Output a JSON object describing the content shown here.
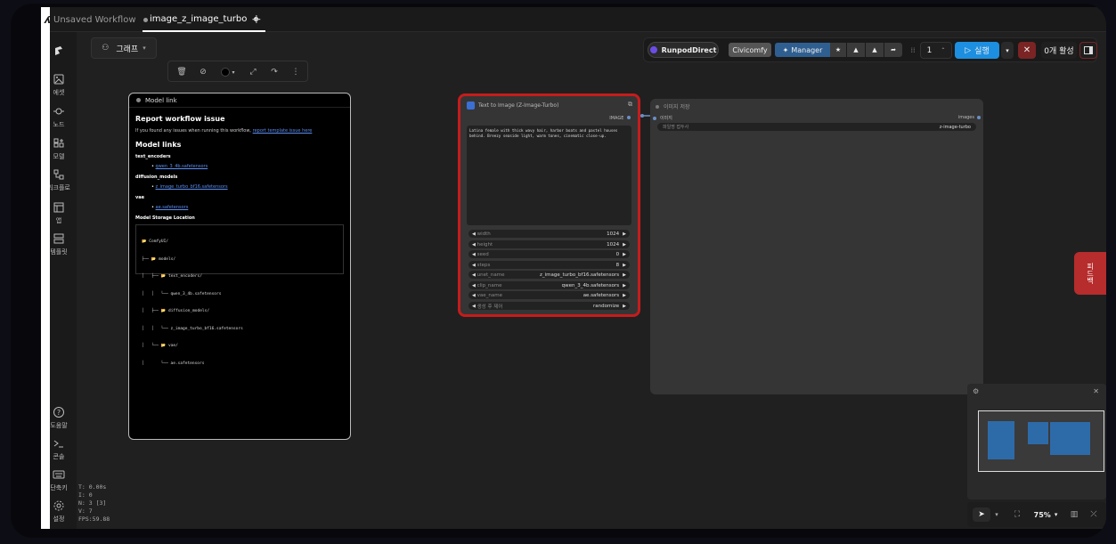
{
  "tabs": [
    {
      "label": "Unsaved Workflow"
    },
    {
      "label": "image_z_image_turbo"
    }
  ],
  "graph_menu": {
    "label": "그래프"
  },
  "sidebar": {
    "items": [
      {
        "label": "에셋"
      },
      {
        "label": "노드"
      },
      {
        "label": "모델"
      },
      {
        "label": "워크플로"
      },
      {
        "label": "앱"
      },
      {
        "label": "템플릿"
      },
      {
        "label": "도움말"
      },
      {
        "label": "콘솔"
      },
      {
        "label": "단축키"
      },
      {
        "label": "설정"
      }
    ]
  },
  "stats": {
    "t": "T: 0.00s",
    "i": "I: 0",
    "n": "N: 3 [3]",
    "v": "V: 7",
    "fps": "FPS:59.88"
  },
  "topbar": {
    "runpod": "RunpodDirect",
    "civicomfy": "Civicomfy",
    "manager": "Manager",
    "queue_count": "1",
    "run": "실행",
    "active": "0개 활성"
  },
  "model_link_node": {
    "title": "Model link",
    "heading": "Report workflow issue",
    "intro": "If you found any issues when running this workflow,",
    "intro_link": "report template issue here",
    "models_heading": "Model links",
    "text_encoders_label": "text_encoders",
    "text_encoders_file": "qwen_3_4b.safetensors",
    "diffusion_label": "diffusion_models",
    "diffusion_file": "z_image_turbo_bf16.safetensors",
    "vae_label": "vae",
    "vae_file": "ae.safetensors",
    "storage_heading": "Model Storage Location",
    "tree": [
      "📂 ComfyUI/",
      "├── 📂 models/",
      "│   ├── 📂 text_encoders/",
      "│   │   └── qwen_3_4b.safetensors",
      "│   ├── 📂 diffusion_models/",
      "│   │   └── z_image_turbo_bf16.safetensors",
      "│   └── 📂 vae/",
      "│       └── ae.safetensors"
    ]
  },
  "t2i_node": {
    "title": "Text to Image (Z-Image-Turbo)",
    "output_label": "IMAGE",
    "prompt": "Latina female with thick wavy hair, harbor boats and pastel houses behind. Breezy seaside light, warm tones, cinematic close-up.",
    "widgets": [
      {
        "label": "width",
        "value": "1024"
      },
      {
        "label": "height",
        "value": "1024"
      },
      {
        "label": "seed",
        "value": "0"
      },
      {
        "label": "steps",
        "value": "8"
      },
      {
        "label": "unet_name",
        "value": "z_image_turbo_bf16.safetensors"
      },
      {
        "label": "clip_name",
        "value": "qwen_3_4b.safetensors"
      },
      {
        "label": "vae_name",
        "value": "ae.safetensors"
      },
      {
        "label": "생성 후 제어",
        "value": "randomize"
      }
    ]
  },
  "save_node": {
    "title": "이미지 저장",
    "input_label": "이미지",
    "output_label": "images",
    "prefix_label": "파일명 접두사",
    "prefix_value": "z-image-turbo"
  },
  "zoom": {
    "value": "75%"
  },
  "feedback": {
    "label": "피드백"
  }
}
